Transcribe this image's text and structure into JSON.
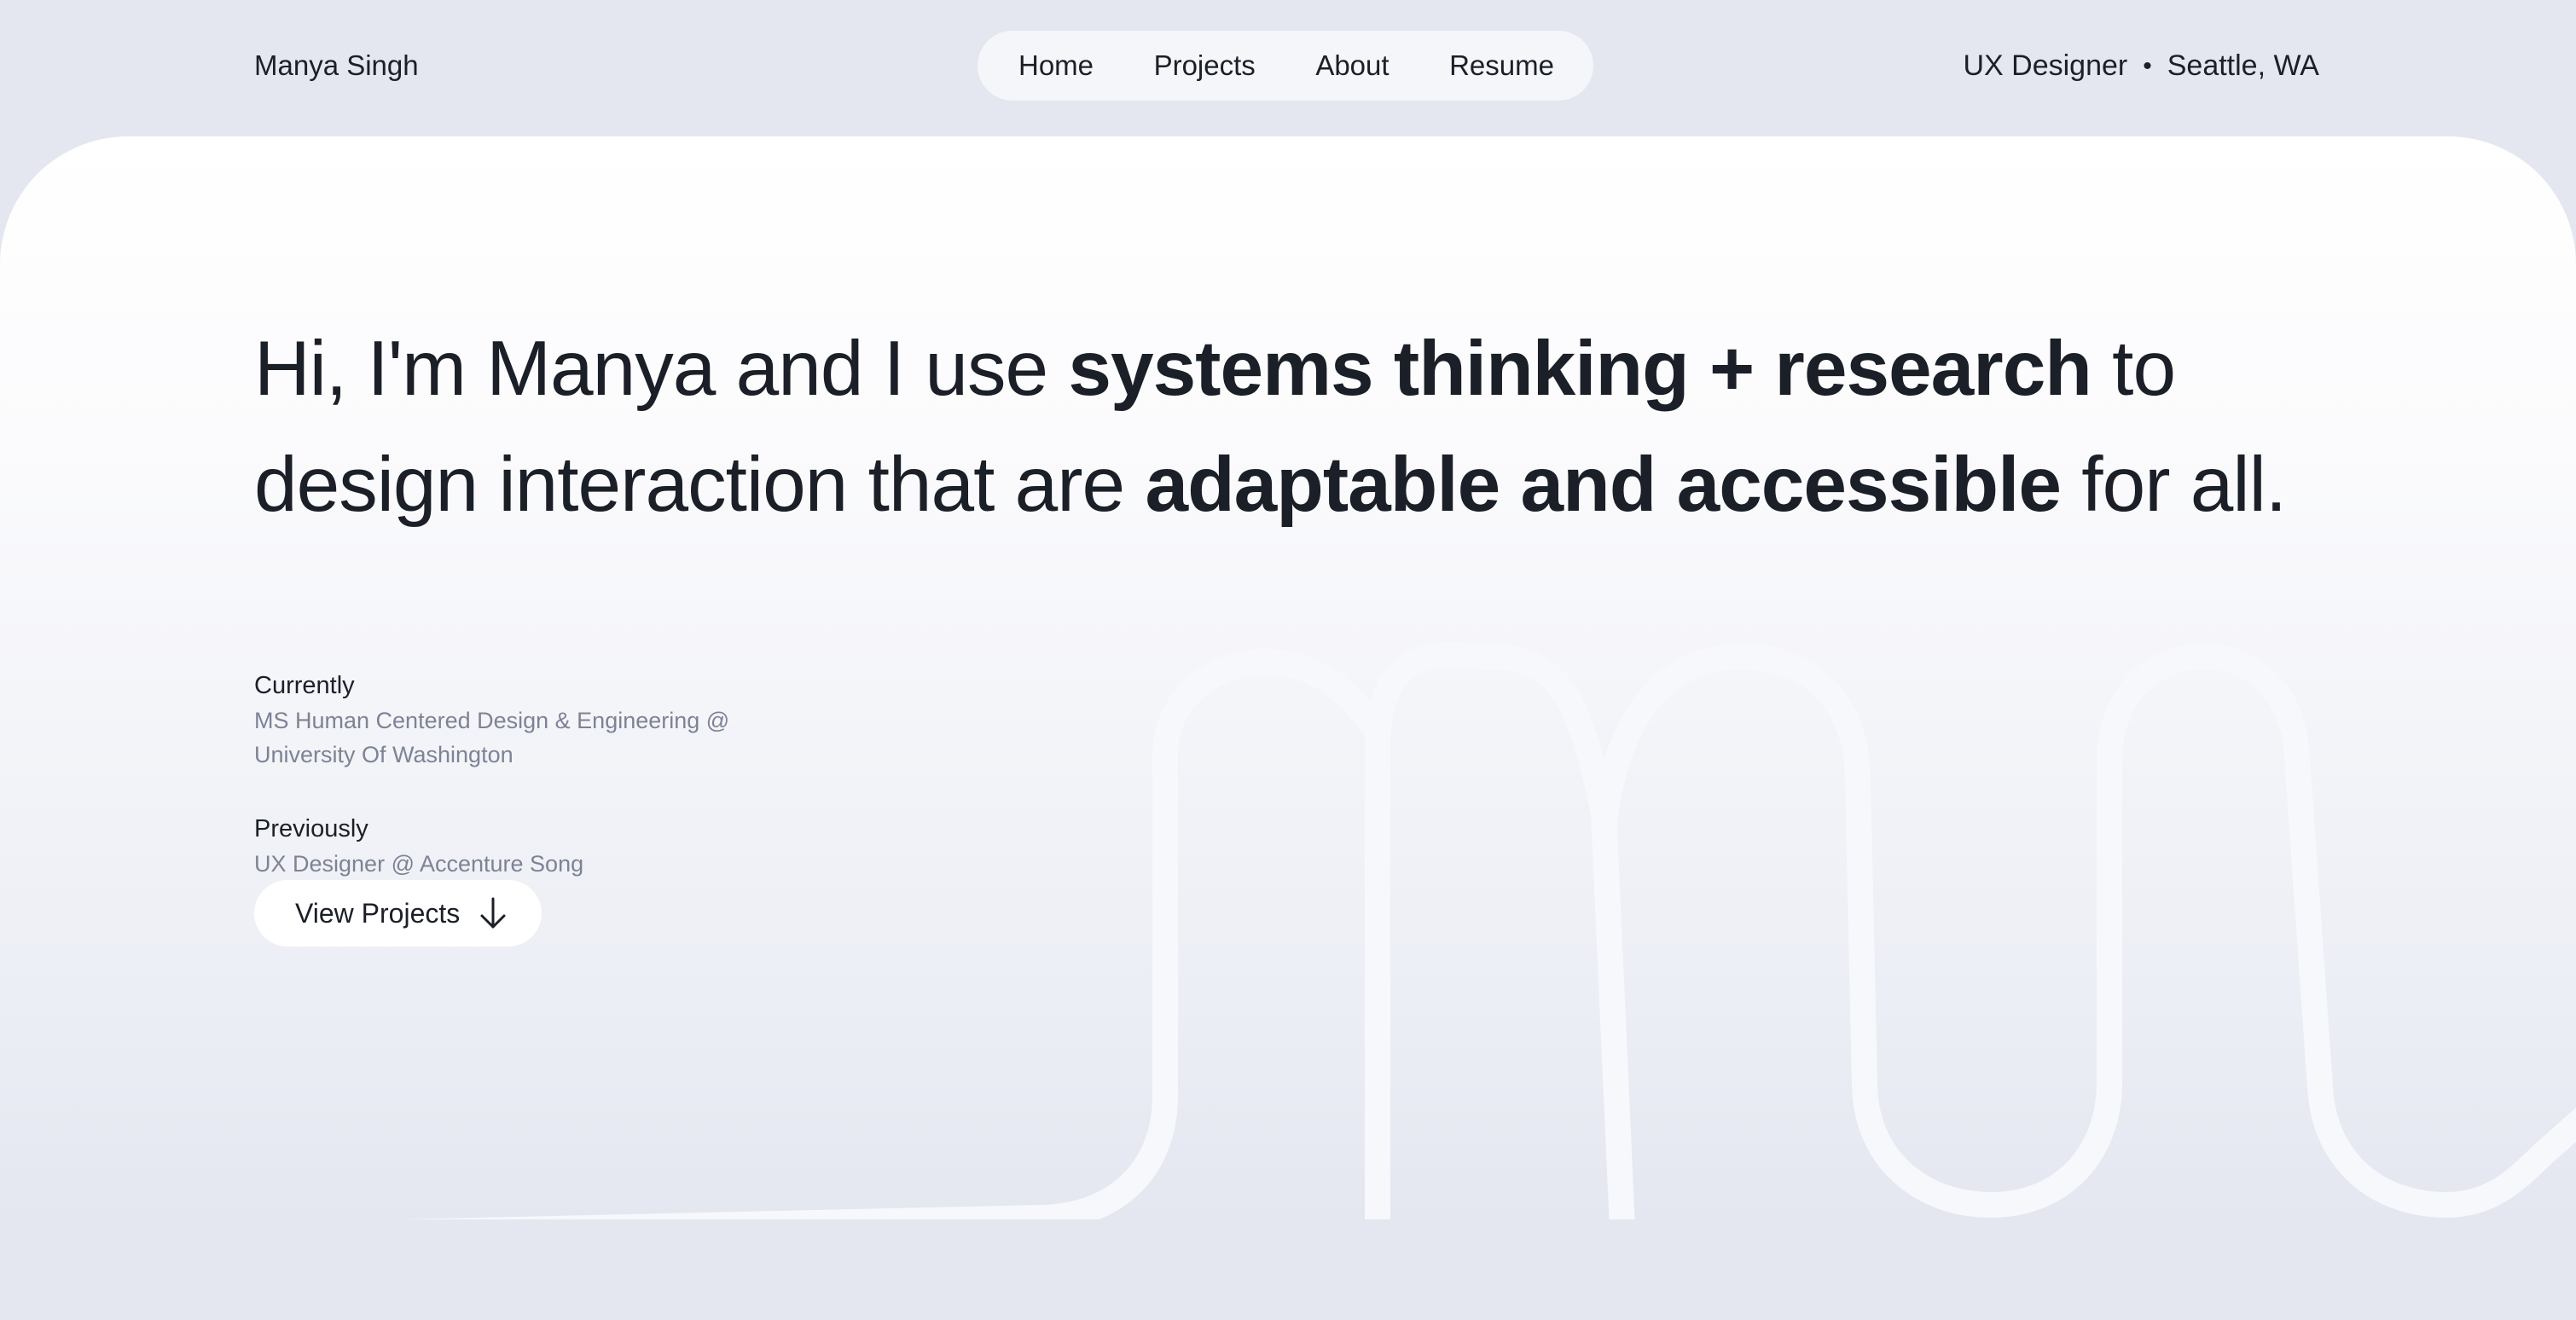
{
  "header": {
    "brand_name": "Manya Singh",
    "nav": {
      "items": [
        {
          "label": "Home"
        },
        {
          "label": "Projects"
        },
        {
          "label": "About"
        },
        {
          "label": "Resume"
        }
      ]
    },
    "role": "UX Designer",
    "separator": "•",
    "location": "Seattle, WA"
  },
  "hero": {
    "headline": {
      "part1": "Hi, I'm Manya and I use ",
      "emphasis1": "systems thinking + research",
      "part2": " to design interaction that are ",
      "emphasis2": "adaptable and accessible",
      "part3": " for all."
    },
    "currently": {
      "label": "Currently",
      "value": "MS Human Centered Design & Engineering @ University Of Washington"
    },
    "previously": {
      "label": "Previously",
      "value": "UX Designer @ Accenture Song"
    },
    "cta": {
      "label": "View Projects",
      "icon": "arrow-down-icon"
    }
  },
  "colors": {
    "background": "#e4e7f0",
    "text": "#1b1f27",
    "muted_text": "#7d8396",
    "surface": "#ffffff",
    "curve": "#f7f8fc"
  }
}
